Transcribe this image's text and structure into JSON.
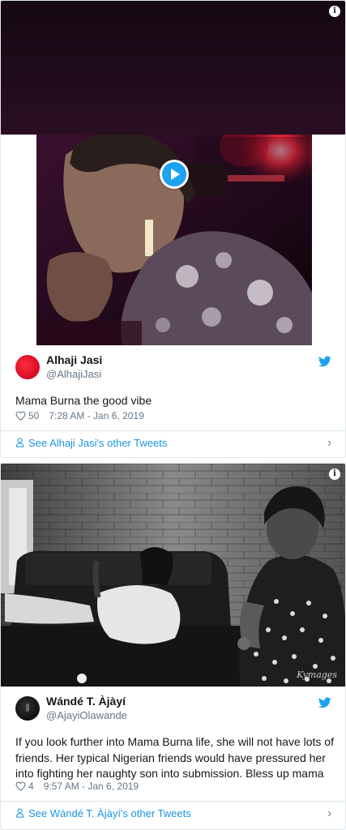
{
  "tweets": [
    {
      "display_name": "Alhaji Jasi",
      "handle": "@AlhajiJasi",
      "text": "Mama Burna the good vibe",
      "likes": "50",
      "timestamp": "7:28 AM - Jan 6, 2019",
      "see_more": "See Alhaji Jasi's other Tweets"
    },
    {
      "display_name": "Wándé T. Àjàyí",
      "handle": "@AjayiOlawande",
      "text": "If you look further into Mama Burna life, she will not have lots of friends. Her typical Nigerian friends would have pressured her into fighting her naughty son into submission. Bless up mama",
      "likes": "4",
      "timestamp": "9:57 AM - Jan 6, 2019",
      "see_more": "See Wándé T. Àjàyí's other Tweets"
    }
  ],
  "media": {
    "info_glyph": "i",
    "watermark": "Kymages"
  },
  "icons": {
    "chevron": "›"
  },
  "colors": {
    "link": "#1b95e0",
    "twitter_blue": "#1da1f2",
    "meta_gray": "#657786",
    "border": "#e1e8ed"
  }
}
